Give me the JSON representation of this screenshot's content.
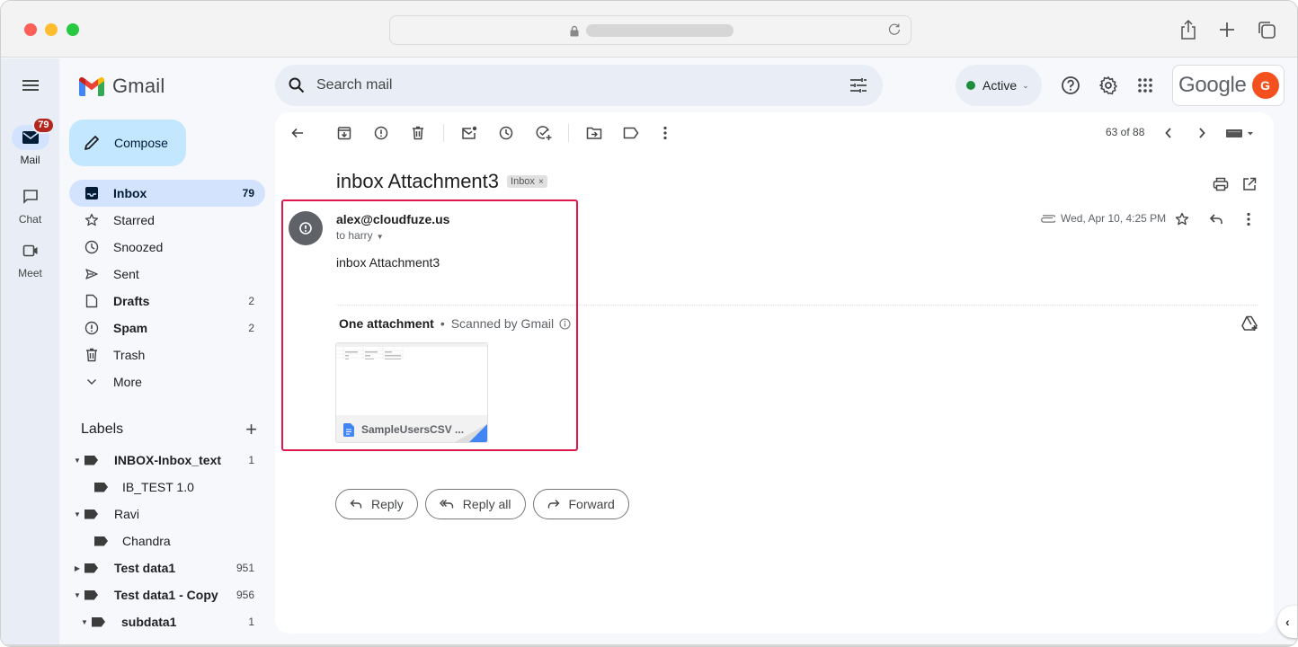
{
  "browser": {
    "reload_icon": "reload-icon",
    "share_icon": "share-icon",
    "new_tab_icon": "plus-icon",
    "tabs_icon": "tabs-overview-icon"
  },
  "rail": {
    "items": [
      {
        "label": "Mail",
        "icon": "mail-icon",
        "badge": "79",
        "active": true
      },
      {
        "label": "Chat",
        "icon": "chat-icon"
      },
      {
        "label": "Meet",
        "icon": "video-icon"
      }
    ]
  },
  "app": {
    "name": "Gmail",
    "compose_label": "Compose"
  },
  "nav": {
    "items": [
      {
        "label": "Inbox",
        "count": "79",
        "icon": "inbox-icon",
        "active": true
      },
      {
        "label": "Starred",
        "count": "",
        "icon": "star-icon"
      },
      {
        "label": "Snoozed",
        "count": "",
        "icon": "clock-icon"
      },
      {
        "label": "Sent",
        "count": "",
        "icon": "send-icon"
      },
      {
        "label": "Drafts",
        "count": "2",
        "icon": "draft-icon",
        "bold": true
      },
      {
        "label": "Spam",
        "count": "2",
        "icon": "spam-icon",
        "bold": true
      },
      {
        "label": "Trash",
        "count": "",
        "icon": "trash-icon"
      },
      {
        "label": "More",
        "count": "",
        "icon": "chevron-down-icon"
      }
    ]
  },
  "labels": {
    "title": "Labels",
    "add_icon": "plus-icon",
    "items": [
      {
        "name": "INBOX-Inbox_text",
        "count": "1",
        "caret": "down",
        "bold": true,
        "level": 0
      },
      {
        "name": "IB_TEST 1.0",
        "count": "",
        "caret": "",
        "bold": false,
        "level": 1
      },
      {
        "name": "Ravi",
        "count": "",
        "caret": "down",
        "bold": false,
        "level": 0
      },
      {
        "name": "Chandra",
        "count": "",
        "caret": "",
        "bold": false,
        "level": 1
      },
      {
        "name": "Test data1",
        "count": "951",
        "caret": "right",
        "bold": true,
        "level": 0
      },
      {
        "name": "Test data1 - Copy",
        "count": "956",
        "caret": "down",
        "bold": true,
        "level": 0
      },
      {
        "name": "subdata1",
        "count": "1",
        "caret": "down",
        "bold": true,
        "level": 1
      }
    ]
  },
  "header": {
    "search_placeholder": "Search mail",
    "status_label": "Active",
    "status_color": "#1e8e3e",
    "brand_word": "Google",
    "avatar_letter": "G",
    "avatar_color": "#f4511e"
  },
  "toolbar": {
    "page_count": "63 of 88",
    "buttons": [
      "back-arrow-icon",
      "archive-icon",
      "report-spam-icon",
      "delete-icon",
      "mark-unread-icon",
      "snooze-icon",
      "add-task-icon",
      "move-to-icon",
      "label-icon",
      "more-vert-icon"
    ]
  },
  "message": {
    "subject": "inbox Attachment3",
    "chip_label": "Inbox",
    "chip_close": "×",
    "sender": "alex@cloudfuze.us",
    "to": "to harry",
    "date": "Wed, Apr 10, 4:25 PM",
    "body": "inbox Attachment3",
    "attachment_count_label": "One attachment",
    "scanned_label": "Scanned by Gmail",
    "attachment_name": "SampleUsersCSV ...",
    "highlight_color": "#e0174d"
  },
  "actions": {
    "reply": "Reply",
    "reply_all": "Reply all",
    "forward": "Forward"
  }
}
